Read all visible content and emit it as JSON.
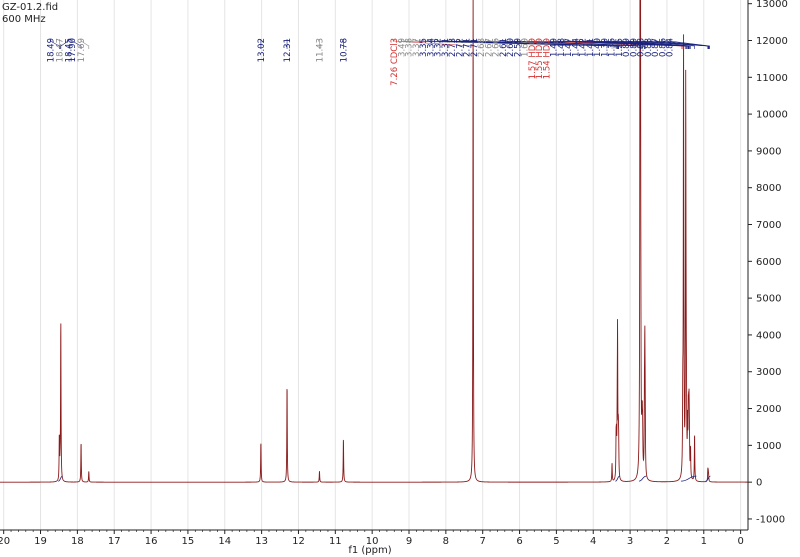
{
  "header": {
    "filename": "GZ-01.2.fid",
    "frequency": "600 MHz"
  },
  "colors": {
    "spectrum": "#8b1a1a",
    "label_dark": "#1a237e",
    "label_grey": "#8a8a8a",
    "label_red": "#d32f2f",
    "axis": "#222222",
    "integral": "#1a237e"
  },
  "chart_data": {
    "type": "line",
    "title": "",
    "xlabel": "f1 (ppm)",
    "ylabel": "",
    "xlim": [
      20.1,
      -0.2
    ],
    "ylim": [
      -1300,
      13100
    ],
    "x_reversed": true,
    "grid": true,
    "x_ticks": [
      20,
      19,
      18,
      17,
      16,
      15,
      14,
      13,
      12,
      11,
      10,
      9,
      8,
      7,
      6,
      5,
      4,
      3,
      2,
      1,
      0
    ],
    "x_tick_labels": [
      "20",
      "19",
      "18",
      "17",
      "16",
      "15",
      "14",
      "13",
      "12",
      "11",
      "10",
      "9",
      "8",
      "7",
      "6",
      "5",
      "4",
      "3",
      "2",
      "1",
      "0"
    ],
    "y_ticks": [
      -1000,
      0,
      1000,
      2000,
      3000,
      4000,
      5000,
      6000,
      7000,
      8000,
      9000,
      10000,
      11000,
      12000,
      13000
    ],
    "y_tick_labels": [
      "-1000",
      "0",
      "1000",
      "2000",
      "3000",
      "4000",
      "5000",
      "6000",
      "7000",
      "8000",
      "9000",
      "10000",
      "11000",
      "12000",
      "13000"
    ],
    "peaks": [
      {
        "ppm": 18.49,
        "intensity": 1200
      },
      {
        "ppm": 18.47,
        "intensity": 300
      },
      {
        "ppm": 18.45,
        "intensity": 4400
      },
      {
        "ppm": 17.9,
        "intensity": 1100
      },
      {
        "ppm": 17.69,
        "intensity": 300
      },
      {
        "ppm": 13.02,
        "intensity": 1100
      },
      {
        "ppm": 12.31,
        "intensity": 2700
      },
      {
        "ppm": 11.43,
        "intensity": 300
      },
      {
        "ppm": 10.78,
        "intensity": 1200
      },
      {
        "ppm": 7.26,
        "intensity": 13500
      },
      {
        "ppm": 3.49,
        "intensity": 500
      },
      {
        "ppm": 3.38,
        "intensity": 1000
      },
      {
        "ppm": 3.37,
        "intensity": 900
      },
      {
        "ppm": 3.35,
        "intensity": 1200
      },
      {
        "ppm": 3.34,
        "intensity": 3800
      },
      {
        "ppm": 3.32,
        "intensity": 1100
      },
      {
        "ppm": 3.31,
        "intensity": 800
      },
      {
        "ppm": 2.73,
        "intensity": 13500
      },
      {
        "ppm": 2.72,
        "intensity": 13500
      },
      {
        "ppm": 2.71,
        "intensity": 2000
      },
      {
        "ppm": 2.68,
        "intensity": 1000
      },
      {
        "ppm": 2.67,
        "intensity": 1000
      },
      {
        "ppm": 2.66,
        "intensity": 1000
      },
      {
        "ppm": 2.61,
        "intensity": 1800
      },
      {
        "ppm": 2.6,
        "intensity": 3100
      },
      {
        "ppm": 2.59,
        "intensity": 1500
      },
      {
        "ppm": 1.57,
        "intensity": 1800
      },
      {
        "ppm": 1.55,
        "intensity": 11100
      },
      {
        "ppm": 1.54,
        "intensity": 2500
      },
      {
        "ppm": 1.49,
        "intensity": 10300
      },
      {
        "ppm": 1.48,
        "intensity": 1600
      },
      {
        "ppm": 1.47,
        "intensity": 1400
      },
      {
        "ppm": 1.44,
        "intensity": 1300
      },
      {
        "ppm": 1.42,
        "intensity": 1400
      },
      {
        "ppm": 1.41,
        "intensity": 1200
      },
      {
        "ppm": 1.4,
        "intensity": 1500
      },
      {
        "ppm": 1.39,
        "intensity": 900
      },
      {
        "ppm": 1.36,
        "intensity": 800
      },
      {
        "ppm": 1.25,
        "intensity": 1300
      },
      {
        "ppm": 0.89,
        "intensity": 300
      },
      {
        "ppm": 0.88,
        "intensity": 200
      },
      {
        "ppm": 0.87,
        "intensity": 150
      }
    ],
    "peak_labels": [
      {
        "ppm": 18.49,
        "text": "18.49",
        "style": "dark",
        "group": 1
      },
      {
        "ppm": 18.47,
        "text": "18.47",
        "style": "grey",
        "group": 1
      },
      {
        "ppm": 18.45,
        "text": "18.45",
        "style": "dark",
        "group": 1
      },
      {
        "ppm": 17.9,
        "text": "17.90",
        "style": "dark",
        "group": 2
      },
      {
        "ppm": 17.69,
        "text": "17.69",
        "style": "grey",
        "group": 2
      },
      {
        "ppm": 13.02,
        "text": "13.02",
        "style": "dark",
        "group": 3
      },
      {
        "ppm": 12.31,
        "text": "12.31",
        "style": "dark",
        "group": 4
      },
      {
        "ppm": 11.43,
        "text": "11.43",
        "style": "grey",
        "group": 5
      },
      {
        "ppm": 10.78,
        "text": "10.78",
        "style": "dark",
        "group": 6
      },
      {
        "ppm": 7.26,
        "text": "7.26 CDCl3",
        "style": "red",
        "group": 7
      },
      {
        "ppm": 3.49,
        "text": "3.49",
        "style": "grey",
        "group": 7
      },
      {
        "ppm": 3.38,
        "text": "3.38",
        "style": "grey",
        "group": 7
      },
      {
        "ppm": 3.37,
        "text": "3.37",
        "style": "grey",
        "group": 7
      },
      {
        "ppm": 3.35,
        "text": "3.35",
        "style": "dark",
        "group": 7
      },
      {
        "ppm": 3.34,
        "text": "3.34",
        "style": "dark",
        "group": 7
      },
      {
        "ppm": 3.32,
        "text": "3.32",
        "style": "dark",
        "group": 7
      },
      {
        "ppm": 3.31,
        "text": "3.31",
        "style": "dark",
        "group": 7
      },
      {
        "ppm": 2.73,
        "text": "2.73",
        "style": "dark",
        "group": 7
      },
      {
        "ppm": 2.72,
        "text": "2.72",
        "style": "dark",
        "group": 7
      },
      {
        "ppm": 2.71,
        "text": "2.71",
        "style": "dark",
        "group": 7
      },
      {
        "ppm": 2.71,
        "text": "2.71",
        "style": "dark",
        "group": 7
      },
      {
        "ppm": 2.68,
        "text": "2.68",
        "style": "grey",
        "group": 7
      },
      {
        "ppm": 2.67,
        "text": "2.67",
        "style": "grey",
        "group": 7
      },
      {
        "ppm": 2.66,
        "text": "2.66",
        "style": "grey",
        "group": 7
      },
      {
        "ppm": 2.61,
        "text": "2.61",
        "style": "dark",
        "group": 7
      },
      {
        "ppm": 2.6,
        "text": "2.60",
        "style": "dark",
        "group": 7
      },
      {
        "ppm": 2.59,
        "text": "2.59",
        "style": "dark",
        "group": 7
      },
      {
        "ppm": 1.6,
        "text": "1.60",
        "style": "grey",
        "group": 7
      },
      {
        "ppm": 1.57,
        "text": "1.57 HDO",
        "style": "red",
        "group": 7
      },
      {
        "ppm": 1.55,
        "text": "1.55 HDO",
        "style": "red",
        "group": 7
      },
      {
        "ppm": 1.54,
        "text": "1.54 HDO",
        "style": "red",
        "group": 7
      },
      {
        "ppm": 1.49,
        "text": "1.49",
        "style": "dark",
        "group": 7
      },
      {
        "ppm": 1.48,
        "text": "1.48",
        "style": "dark",
        "group": 7
      },
      {
        "ppm": 1.47,
        "text": "1.47",
        "style": "dark",
        "group": 7
      },
      {
        "ppm": 1.44,
        "text": "1.44",
        "style": "dark",
        "group": 7
      },
      {
        "ppm": 1.42,
        "text": "1.42",
        "style": "dark",
        "group": 7
      },
      {
        "ppm": 1.41,
        "text": "1.41",
        "style": "dark",
        "group": 7
      },
      {
        "ppm": 1.4,
        "text": "1.40",
        "style": "dark",
        "group": 7
      },
      {
        "ppm": 1.39,
        "text": "1.39",
        "style": "dark",
        "group": 7
      },
      {
        "ppm": 1.36,
        "text": "1.36",
        "style": "dark",
        "group": 7
      },
      {
        "ppm": 1.25,
        "text": "1.25",
        "style": "dark",
        "group": 7
      },
      {
        "ppm": 0.89,
        "text": "0.89",
        "style": "dark",
        "group": 7
      },
      {
        "ppm": 0.89,
        "text": "0.89",
        "style": "dark",
        "group": 7
      },
      {
        "ppm": 0.88,
        "text": "0.88",
        "style": "dark",
        "group": 7
      },
      {
        "ppm": 0.88,
        "text": "0.88",
        "style": "dark",
        "group": 7
      },
      {
        "ppm": 0.87,
        "text": "0.87",
        "style": "dark",
        "group": 7
      },
      {
        "ppm": 0.86,
        "text": "0.86",
        "style": "dark",
        "group": 7
      },
      {
        "ppm": 0.84,
        "text": "0.84",
        "style": "dark",
        "group": 7
      }
    ]
  }
}
